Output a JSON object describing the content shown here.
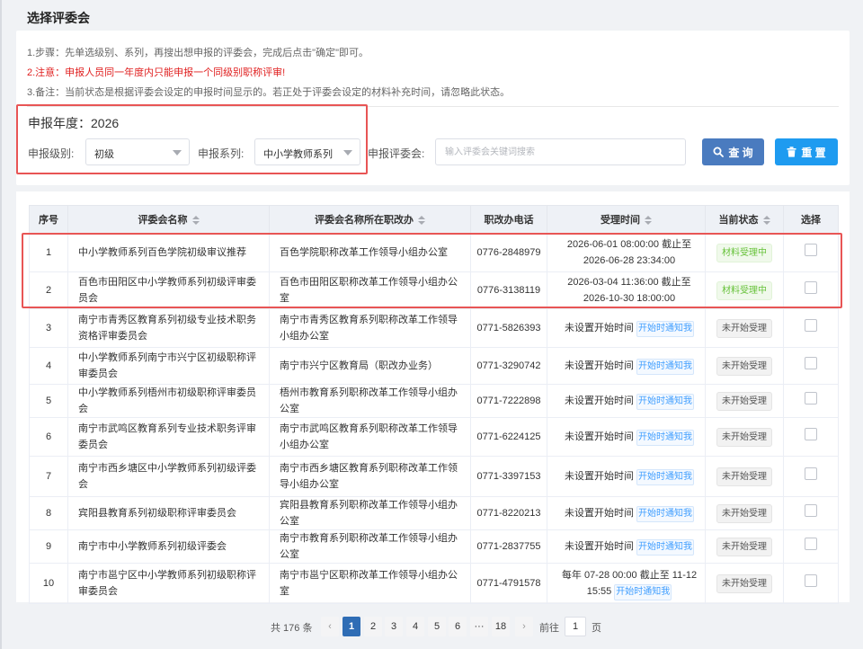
{
  "page_title": "选择评委会",
  "notes": [
    "1.步骤：先单选级别、系列，再搜出想申报的评委会，完成后点击\"确定\"即可。",
    "2.注意：申报人员同一年度内只能申报一个同级别职称评审!",
    "3.备注：当前状态是根据评委会设定的申报时间显示的。若正处于评委会设定的材料补充时间，请忽略此状态。"
  ],
  "year_label": "申报年度：2026",
  "filters": {
    "level_label": "申报级别:",
    "level_value": "初级",
    "series_label": "申报系列:",
    "series_value": "中小学教师系列",
    "committee_label": "申报评委会:",
    "search_placeholder": "输入评委会关键词搜索"
  },
  "buttons": {
    "query": "查 询",
    "reset": "重 置"
  },
  "colors": {
    "query_button": "#4a7bbf",
    "reset_button": "#1e9bf0",
    "warning_text": "#e02020",
    "highlight_box": "#e85555",
    "status_accepting": "#67c23a",
    "active_page": "#2f6db5"
  },
  "table": {
    "headers": [
      "序号",
      "评委会名称",
      "评委会名称所在职改办",
      "职改办电话",
      "受理时间",
      "当前状态",
      "选择"
    ],
    "rows": [
      {
        "no": "1",
        "name": "中小学教师系列百色学院初级审议推荐",
        "office": "百色学院职称改革工作领导小组办公室",
        "phone": "0776-2848979",
        "time": "2026-06-01 08:00:00 截止至 2026-06-28 23:34:00",
        "notify": "",
        "status": "材料受理中",
        "status_type": "ok"
      },
      {
        "no": "2",
        "name": "百色市田阳区中小学教师系列初级评审委员会",
        "office": "百色市田阳区职称改革工作领导小组办公室",
        "phone": "0776-3138119",
        "time": "2026-03-04 11:36:00 截止至 2026-10-30 18:00:00",
        "notify": "",
        "status": "材料受理中",
        "status_type": "ok"
      },
      {
        "no": "3",
        "name": "南宁市青秀区教育系列初级专业技术职务资格评审委员会",
        "office": "南宁市青秀区教育系列职称改革工作领导小组办公室",
        "phone": "0771-5826393",
        "time": "未设置开始时间",
        "notify": "开始时通知我",
        "status": "未开始受理",
        "status_type": "no"
      },
      {
        "no": "4",
        "name": "中小学教师系列南宁市兴宁区初级职称评审委员会",
        "office": "南宁市兴宁区教育局（职改办业务）",
        "phone": "0771-3290742",
        "time": "未设置开始时间",
        "notify": "开始时通知我",
        "status": "未开始受理",
        "status_type": "no"
      },
      {
        "no": "5",
        "name": "中小学教师系列梧州市初级职称评审委员会",
        "office": "梧州市教育系列职称改革工作领导小组办公室",
        "phone": "0771-7222898",
        "time": "未设置开始时间",
        "notify": "开始时通知我",
        "status": "未开始受理",
        "status_type": "no"
      },
      {
        "no": "6",
        "name": "南宁市武鸣区教育系列专业技术职务评审委员会",
        "office": "南宁市武鸣区教育系列职称改革工作领导小组办公室",
        "phone": "0771-6224125",
        "time": "未设置开始时间",
        "notify": "开始时通知我",
        "status": "未开始受理",
        "status_type": "no"
      },
      {
        "no": "7",
        "name": "南宁市西乡塘区中小学教师系列初级评委会",
        "office": "南宁市西乡塘区教育系列职称改革工作领导小组办公室",
        "phone": "0771-3397153",
        "time": "未设置开始时间",
        "notify": "开始时通知我",
        "status": "未开始受理",
        "status_type": "no"
      },
      {
        "no": "8",
        "name": "宾阳县教育系列初级职称评审委员会",
        "office": "宾阳县教育系列职称改革工作领导小组办公室",
        "phone": "0771-8220213",
        "time": "未设置开始时间",
        "notify": "开始时通知我",
        "status": "未开始受理",
        "status_type": "no"
      },
      {
        "no": "9",
        "name": "南宁市中小学教师系列初级评委会",
        "office": "南宁市教育系列职称改革工作领导小组办公室",
        "phone": "0771-2837755",
        "time": "未设置开始时间",
        "notify": "开始时通知我",
        "status": "未开始受理",
        "status_type": "no"
      },
      {
        "no": "10",
        "name": "南宁市邕宁区中小学教师系列初级职称评审委员会",
        "office": "南宁市邕宁区职称改革工作领导小组办公室",
        "phone": "0771-4791578",
        "time": "每年 07-28 00:00 截止至 11-12 15:55",
        "notify": "开始时通知我",
        "status": "未开始受理",
        "status_type": "no"
      }
    ]
  },
  "pagination": {
    "total": "共 176 条",
    "pages": [
      "1",
      "2",
      "3",
      "4",
      "5",
      "6",
      "···",
      "18"
    ],
    "current": "1",
    "goto_label": "前往",
    "goto_value": "1",
    "page_unit": "页"
  }
}
